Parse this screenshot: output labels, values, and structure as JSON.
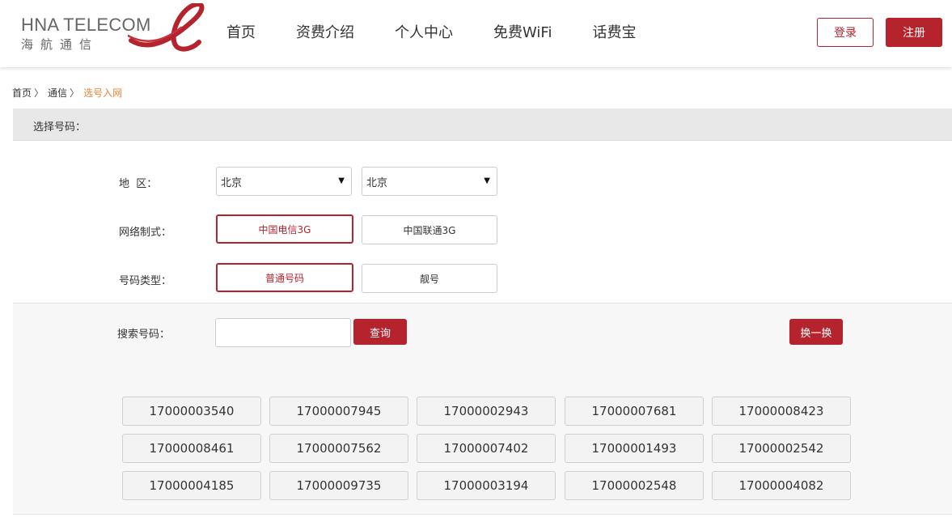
{
  "header": {
    "logo_en": "HNA TELECOM",
    "logo_cn": "海航通信",
    "nav": [
      "首页",
      "资费介绍",
      "个人中心",
      "免费WiFi",
      "话费宝"
    ],
    "login_label": "登录",
    "register_label": "注册"
  },
  "breadcrumb": [
    "首页",
    "通信",
    "选号入网"
  ],
  "breadcrumb_sep": "〉",
  "section": {
    "title": "选择号码："
  },
  "form": {
    "region_label": "地  区：",
    "region_select_1": "北京",
    "region_select_2": "北京",
    "network_label": "网络制式：",
    "network_options": [
      "中国电信3G",
      "中国联通3G"
    ],
    "network_selected": "中国电信3G",
    "type_label": "号码类型：",
    "type_options": [
      "普通号码",
      "靓号"
    ],
    "type_selected": "普通号码"
  },
  "search": {
    "label": "搜索号码：",
    "input_value": "",
    "query_label": "查询",
    "refresh_label": "换一换"
  },
  "numbers": [
    "17000003540",
    "17000007945",
    "17000002943",
    "17000007681",
    "17000008423",
    "17000008461",
    "17000007562",
    "17000007402",
    "17000001493",
    "17000002542",
    "17000004185",
    "17000009735",
    "17000003194",
    "17000002548",
    "17000004082"
  ],
  "colors": {
    "accent": "#b5232d",
    "breadcrumb_active": "#e5873a"
  }
}
